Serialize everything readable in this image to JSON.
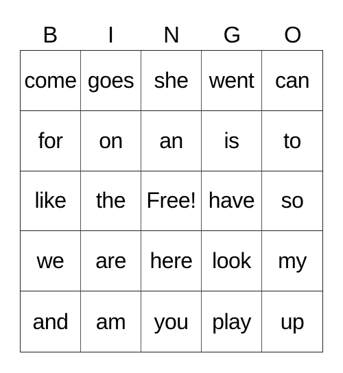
{
  "header": {
    "letters": [
      "B",
      "I",
      "N",
      "G",
      "O"
    ]
  },
  "grid": {
    "rows": [
      [
        "come",
        "goes",
        "she",
        "went",
        "can"
      ],
      [
        "for",
        "on",
        "an",
        "is",
        "to"
      ],
      [
        "like",
        "the",
        "Free!",
        "have",
        "so"
      ],
      [
        "we",
        "are",
        "here",
        "look",
        "my"
      ],
      [
        "and",
        "am",
        "you",
        "play",
        "up"
      ]
    ]
  },
  "colors": {
    "background": "#ffffff",
    "text": "#000000",
    "grid_line": "#222222"
  }
}
